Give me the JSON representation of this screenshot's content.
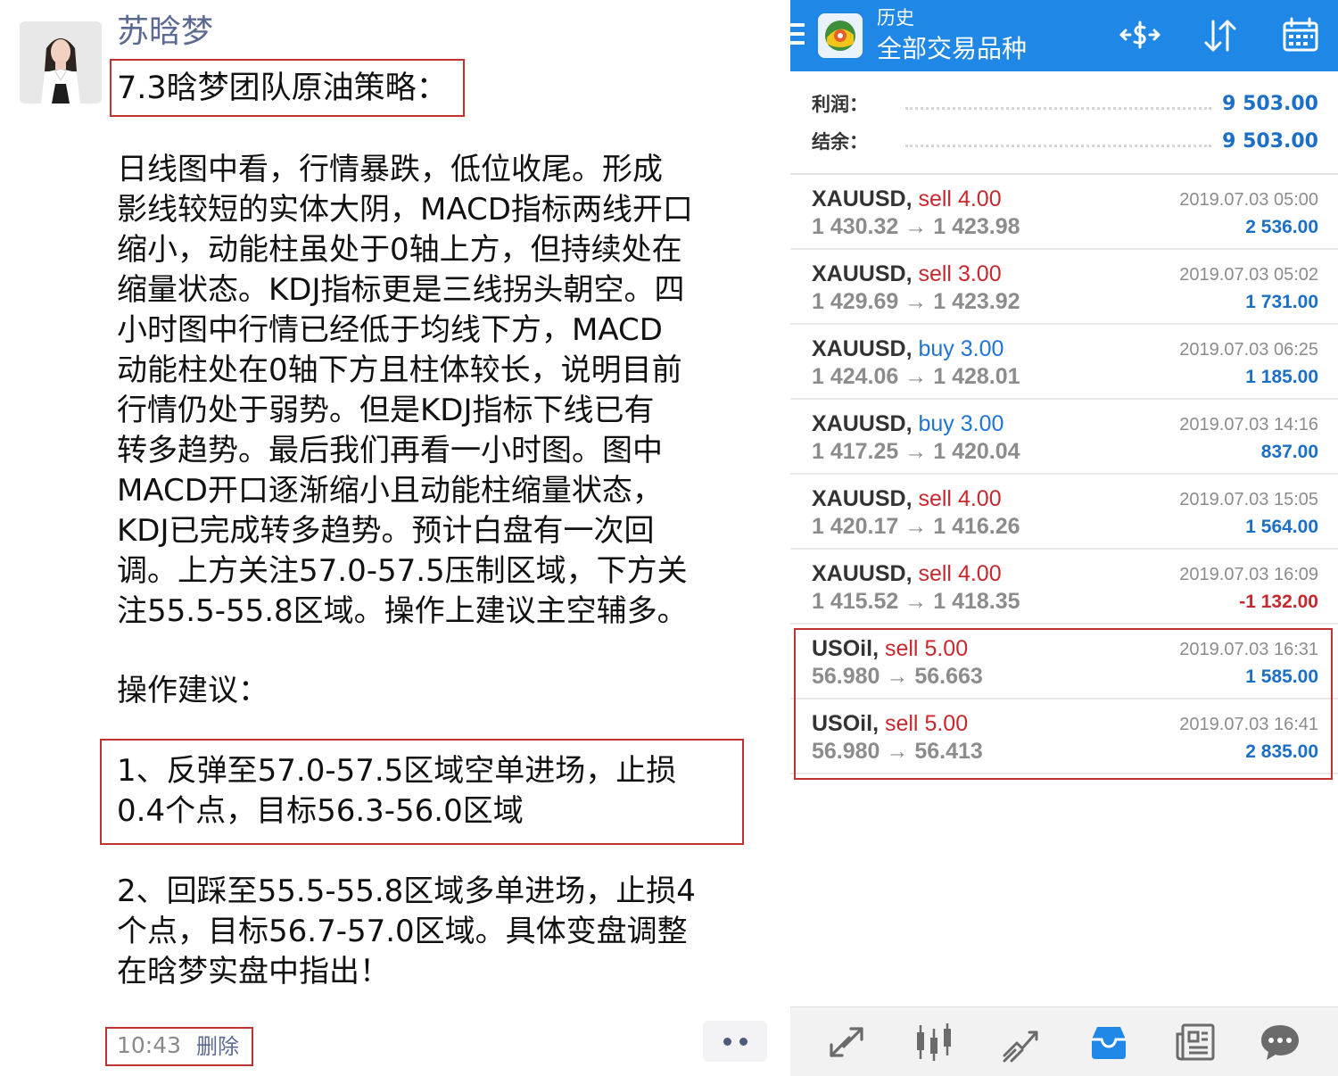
{
  "post": {
    "username": "苏晗梦",
    "title": "7.3晗梦团队原油策略：",
    "paragraph_lines": [
      "日线图中看，行情暴跌，低位收尾。形成",
      "影线较短的实体大阴，MACD指标两线开口",
      "缩小，动能柱虽处于0轴上方，但持续处在",
      "缩量状态。KDJ指标更是三线拐头朝空。四",
      "小时图中行情已经低于均线下方，MACD",
      "动能柱处在0轴下方且柱体较长，说明目前",
      "行情仍处于弱势。但是KDJ指标下线已有",
      "转多趋势。最后我们再看一小时图。图中",
      "MACD开口逐渐缩小且动能柱缩量状态，",
      "KDJ已完成转多趋势。预计白盘有一次回",
      "调。上方关注57.0-57.5压制区域，下方关",
      "注55.5-55.8区域。操作上建议主空辅多。"
    ],
    "ops_label": "操作建议：",
    "suggestion1_lines": [
      "1、反弹至57.0-57.5区域空单进场，止损",
      "0.4个点，目标56.3-56.0区域"
    ],
    "suggestion2_lines": [
      "2、回踩至55.5-55.8区域多单进场，止损4",
      "个点，目标56.7-57.0区域。具体变盘调整",
      "在晗梦实盘中指出！"
    ],
    "time": "10:43",
    "delete_label": "删除"
  },
  "app": {
    "header_title": "历史",
    "header_subtitle": "全部交易品种",
    "summary": [
      {
        "label": "利润：",
        "value": "9 503.00"
      },
      {
        "label": "结余：",
        "value": "9 503.00"
      }
    ],
    "trades": [
      {
        "symbol": "XAUUSD,",
        "side": "sell",
        "volume": "4.00",
        "open": "1 430.32",
        "close": "1 423.98",
        "time": "2019.07.03 05:00",
        "profit": "2 536.00",
        "negative": false
      },
      {
        "symbol": "XAUUSD,",
        "side": "sell",
        "volume": "3.00",
        "open": "1 429.69",
        "close": "1 423.92",
        "time": "2019.07.03 05:02",
        "profit": "1 731.00",
        "negative": false
      },
      {
        "symbol": "XAUUSD,",
        "side": "buy",
        "volume": "3.00",
        "open": "1 424.06",
        "close": "1 428.01",
        "time": "2019.07.03 06:25",
        "profit": "1 185.00",
        "negative": false
      },
      {
        "symbol": "XAUUSD,",
        "side": "buy",
        "volume": "3.00",
        "open": "1 417.25",
        "close": "1 420.04",
        "time": "2019.07.03 14:16",
        "profit": "837.00",
        "negative": false
      },
      {
        "symbol": "XAUUSD,",
        "side": "sell",
        "volume": "4.00",
        "open": "1 420.17",
        "close": "1 416.26",
        "time": "2019.07.03 15:05",
        "profit": "1 564.00",
        "negative": false
      },
      {
        "symbol": "XAUUSD,",
        "side": "sell",
        "volume": "4.00",
        "open": "1 415.52",
        "close": "1 418.35",
        "time": "2019.07.03 16:09",
        "profit": "-1 132.00",
        "negative": true
      },
      {
        "symbol": "USOil,",
        "side": "sell",
        "volume": "5.00",
        "open": "56.980",
        "close": "56.663",
        "time": "2019.07.03 16:31",
        "profit": "1 585.00",
        "negative": false
      },
      {
        "symbol": "USOil,",
        "side": "sell",
        "volume": "5.00",
        "open": "56.980",
        "close": "56.413",
        "time": "2019.07.03 16:41",
        "profit": "2 835.00",
        "negative": false
      }
    ],
    "arrow_glyph": "→",
    "icons": {
      "header": [
        "exchange-icon",
        "sort-icon",
        "calendar-icon"
      ],
      "nav": [
        "quotes-icon",
        "chart-icon",
        "trade-icon",
        "history-icon",
        "news-icon",
        "chat-icon"
      ]
    },
    "colors": {
      "accent": "#1f87e5",
      "sell": "#c8282d",
      "buy": "#1f74d6",
      "profit": "#1c6fc9",
      "highlight_box": "#c3322f"
    }
  }
}
